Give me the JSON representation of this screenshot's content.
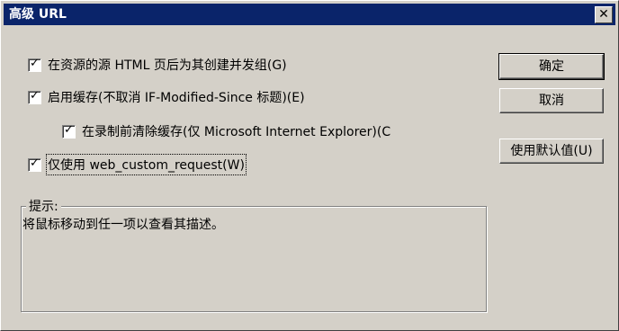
{
  "title": "高级 URL",
  "close_glyph": "✕",
  "options": [
    {
      "label": "在资源的源 HTML 页后为其创建并发组(G)",
      "checked": true
    },
    {
      "label": "启用缓存(不取消 IF-Modified-Since 标题)(E)",
      "checked": true
    },
    {
      "label": "在录制前清除缓存(仅 Microsoft Internet Explorer)(C",
      "checked": true
    },
    {
      "label": "仅使用 web_custom_request(W)",
      "checked": true
    }
  ],
  "buttons": {
    "ok": "确定",
    "cancel": "取消",
    "default": "使用默认值(U)"
  },
  "hint": {
    "title": "提示:",
    "text": "将鼠标移动到任一项以查看其描述。"
  }
}
